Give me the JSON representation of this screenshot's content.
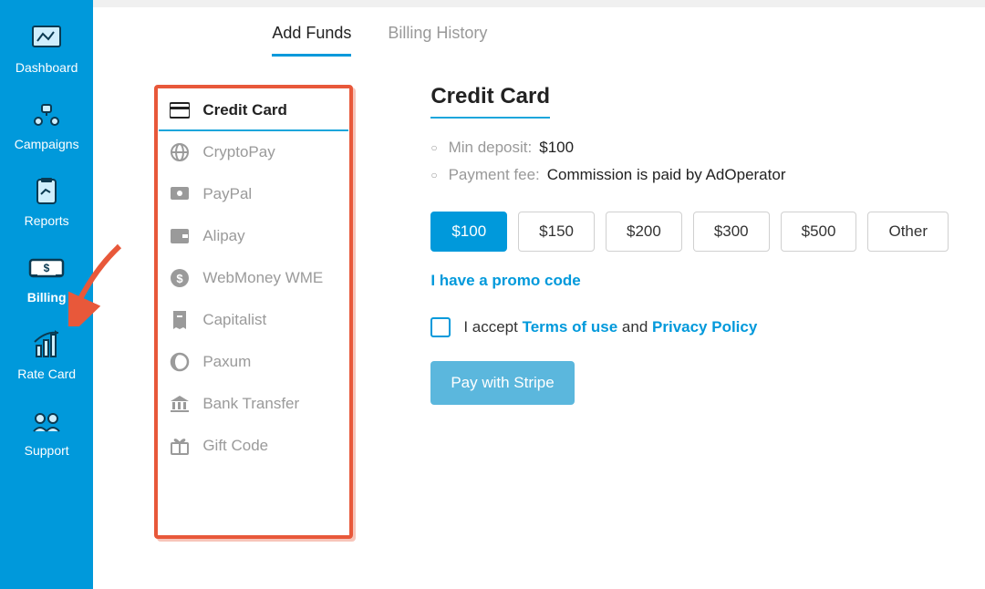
{
  "sidebar": {
    "items": [
      {
        "label": "Dashboard",
        "icon": "dashboard"
      },
      {
        "label": "Campaigns",
        "icon": "campaigns"
      },
      {
        "label": "Reports",
        "icon": "reports"
      },
      {
        "label": "Billing",
        "icon": "billing",
        "active": true
      },
      {
        "label": "Rate Card",
        "icon": "ratecard"
      },
      {
        "label": "Support",
        "icon": "support"
      }
    ]
  },
  "tabs": [
    {
      "label": "Add Funds",
      "active": true
    },
    {
      "label": "Billing History"
    }
  ],
  "paymentMethods": [
    {
      "label": "Credit Card",
      "icon": "card",
      "active": true
    },
    {
      "label": "CryptoPay",
      "icon": "globe"
    },
    {
      "label": "PayPal",
      "icon": "paypal"
    },
    {
      "label": "Alipay",
      "icon": "wallet"
    },
    {
      "label": "WebMoney WME",
      "icon": "dollar-circle"
    },
    {
      "label": "Capitalist",
      "icon": "receipt"
    },
    {
      "label": "Paxum",
      "icon": "circle-moon"
    },
    {
      "label": "Bank Transfer",
      "icon": "bank"
    },
    {
      "label": "Gift Code",
      "icon": "gift"
    }
  ],
  "panel": {
    "title": "Credit Card",
    "minDepositLabel": "Min deposit:",
    "minDepositValue": "$100",
    "feeLabel": "Payment fee:",
    "feeValue": "Commission is paid by AdOperator",
    "amounts": [
      {
        "label": "$100",
        "active": true
      },
      {
        "label": "$150"
      },
      {
        "label": "$200"
      },
      {
        "label": "$300"
      },
      {
        "label": "$500"
      },
      {
        "label": "Other"
      }
    ],
    "promo": "I have a promo code",
    "acceptPrefix": "I accept",
    "terms": "Terms of use",
    "acceptMid": "and",
    "privacy": "Privacy Policy",
    "payButton": "Pay with Stripe"
  }
}
